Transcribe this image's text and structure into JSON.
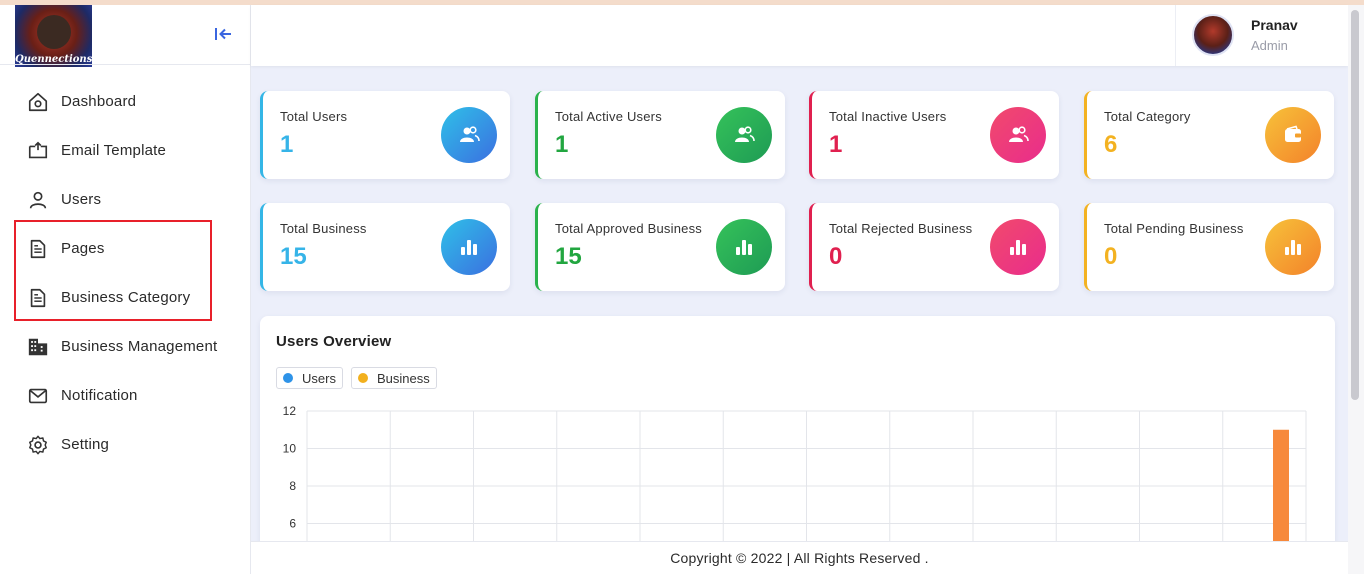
{
  "app": {
    "logo_text": "Quennections"
  },
  "sidebar": {
    "items": [
      {
        "label": "Dashboard",
        "icon": "home-icon"
      },
      {
        "label": "Email Template",
        "icon": "email-template-icon"
      },
      {
        "label": "Users",
        "icon": "user-icon"
      },
      {
        "label": "Pages",
        "icon": "document-icon"
      },
      {
        "label": "Business Category",
        "icon": "document-icon"
      },
      {
        "label": "Business Management",
        "icon": "building-icon"
      },
      {
        "label": "Notification",
        "icon": "mail-icon"
      },
      {
        "label": "Setting",
        "icon": "gear-icon"
      }
    ],
    "highlight_color": "#e8202a"
  },
  "header": {
    "user_name": "Pranav",
    "user_role": "Admin"
  },
  "stats": [
    {
      "title": "Total Users",
      "value": "1",
      "color": "#36b4e8",
      "icon": "users-icon"
    },
    {
      "title": "Total Active Users",
      "value": "1",
      "color": "#22a640",
      "icon": "users-icon"
    },
    {
      "title": "Total Inactive Users",
      "value": "1",
      "color": "#e0204f",
      "icon": "users-icon"
    },
    {
      "title": "Total Category",
      "value": "6",
      "color": "#f3b221",
      "icon": "wallet-icon"
    },
    {
      "title": "Total Business",
      "value": "15",
      "color": "#36b4e8",
      "icon": "bar-chart-icon"
    },
    {
      "title": "Total Approved Business",
      "value": "15",
      "color": "#22a640",
      "icon": "bar-chart-icon"
    },
    {
      "title": "Total Rejected Business",
      "value": "0",
      "color": "#e0204f",
      "icon": "bar-chart-icon"
    },
    {
      "title": "Total Pending Business",
      "value": "0",
      "color": "#f3b221",
      "icon": "bar-chart-icon"
    }
  ],
  "overview": {
    "title": "Users Overview",
    "legend": [
      {
        "label": "Users",
        "color": "#2e93e8"
      },
      {
        "label": "Business",
        "color": "#f2b01e"
      }
    ]
  },
  "chart_data": {
    "type": "bar",
    "ylim": [
      0,
      12
    ],
    "y_ticks": [
      "12",
      "10",
      "8",
      "6"
    ],
    "grid": true,
    "series": [
      {
        "name": "Users",
        "values": [
          0,
          0,
          0,
          0,
          0,
          0,
          0,
          0,
          0,
          0,
          0,
          0
        ]
      },
      {
        "name": "Business",
        "values": [
          0,
          0,
          0,
          0,
          0,
          0,
          0,
          0,
          0,
          0,
          0,
          11
        ]
      }
    ],
    "bar_color": "#f7893b"
  },
  "footer": {
    "text": "Copyright © 2022 | All Rights Reserved ."
  }
}
